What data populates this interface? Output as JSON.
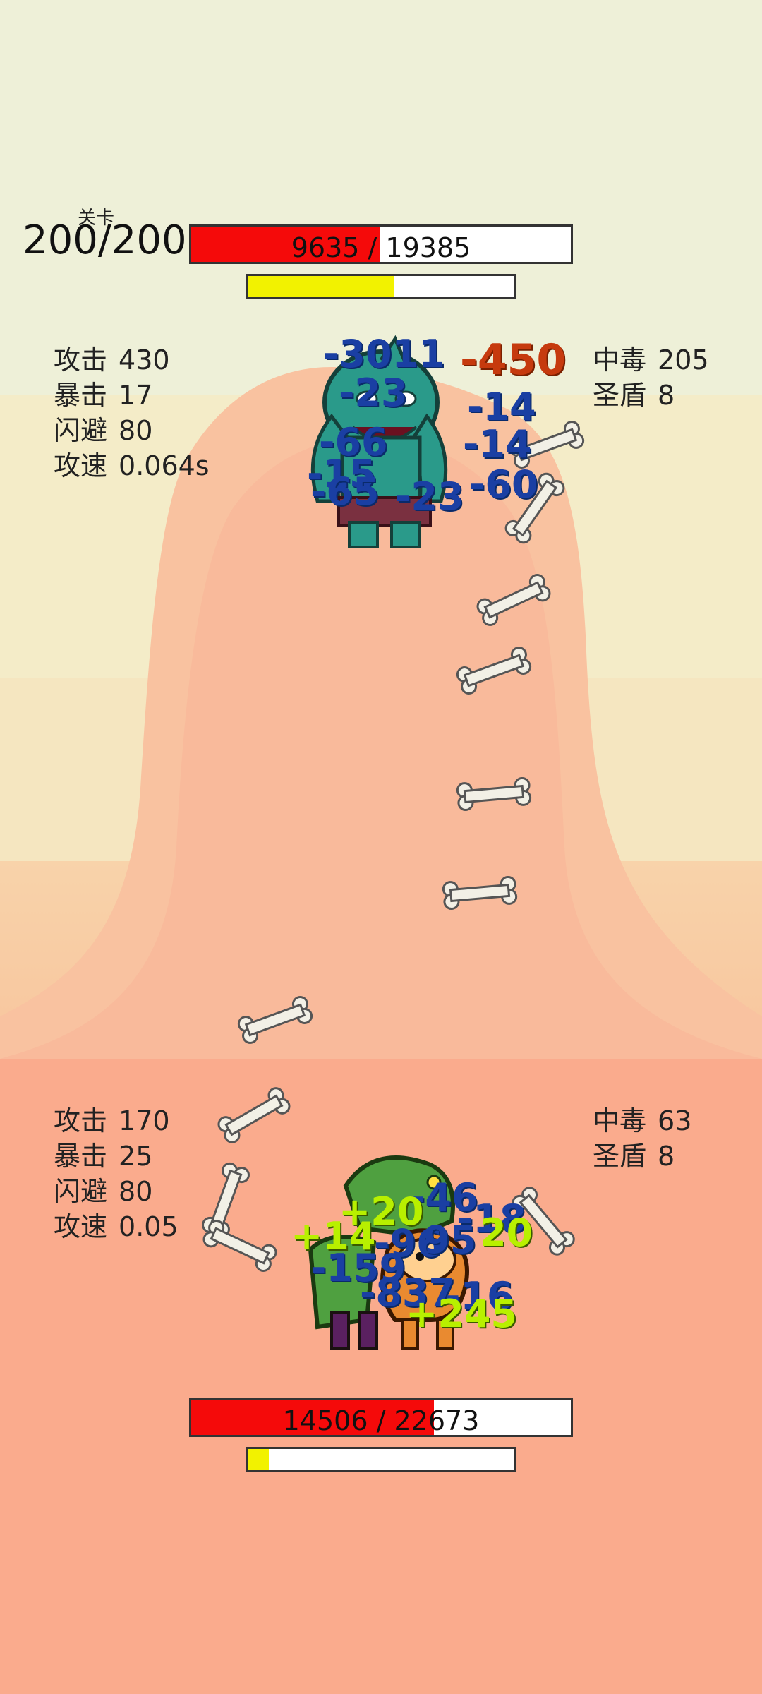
{
  "level": {
    "label": "关卡",
    "value": "200/200"
  },
  "enemy": {
    "hp_text": "9635 / 19385",
    "hp_fraction": 0.497,
    "energy_fraction": 0.55,
    "stats_left": [
      {
        "label": "攻击",
        "value": "430"
      },
      {
        "label": "暴击",
        "value": "17"
      },
      {
        "label": "闪避",
        "value": "80"
      },
      {
        "label": "攻速",
        "value": "0.064s"
      }
    ],
    "stats_right": [
      {
        "label": "中毒",
        "value": "205"
      },
      {
        "label": "圣盾",
        "value": "8"
      }
    ],
    "sprite": "green-ogre-icon"
  },
  "player": {
    "hp_text": "14506 / 22673",
    "hp_fraction": 0.64,
    "energy_fraction": 0.08,
    "stats_left": [
      {
        "label": "攻击",
        "value": "170"
      },
      {
        "label": "暴击",
        "value": "25"
      },
      {
        "label": "闪避",
        "value": "80"
      },
      {
        "label": "攻速",
        "value": "0.05"
      }
    ],
    "stats_right": [
      {
        "label": "中毒",
        "value": "63"
      },
      {
        "label": "圣盾",
        "value": "8"
      }
    ],
    "sprite": "dog-dragon-hero-icon"
  },
  "damage_numbers": [
    {
      "text": "-3011",
      "color": "blue"
    },
    {
      "text": "-450",
      "color": "red"
    },
    {
      "text": "-23",
      "color": "blue"
    },
    {
      "text": "-14",
      "color": "blue"
    },
    {
      "text": "-66",
      "color": "blue"
    },
    {
      "text": "-14",
      "color": "blue"
    },
    {
      "text": "-15",
      "color": "blue"
    },
    {
      "text": "-65",
      "color": "blue"
    },
    {
      "text": "-23",
      "color": "blue"
    },
    {
      "text": "-60",
      "color": "blue"
    },
    {
      "text": "-46",
      "color": "blue"
    },
    {
      "text": "+20",
      "color": "green"
    },
    {
      "text": "-18",
      "color": "blue"
    },
    {
      "text": "+14",
      "color": "green"
    },
    {
      "text": "-96",
      "color": "blue"
    },
    {
      "text": "95",
      "color": "blue"
    },
    {
      "text": "20",
      "color": "green"
    },
    {
      "text": "-159",
      "color": "blue"
    },
    {
      "text": "-837",
      "color": "blue"
    },
    {
      "text": "-16",
      "color": "blue"
    },
    {
      "text": "+245",
      "color": "green"
    }
  ],
  "projectile_icon": "bone-icon",
  "colors": {
    "hp_fill": "#f50a0a",
    "energy_fill": "#f2f200",
    "damage_blue": "#1a3fa3",
    "damage_red": "#c63a0e",
    "heal_green": "#b8f000"
  }
}
